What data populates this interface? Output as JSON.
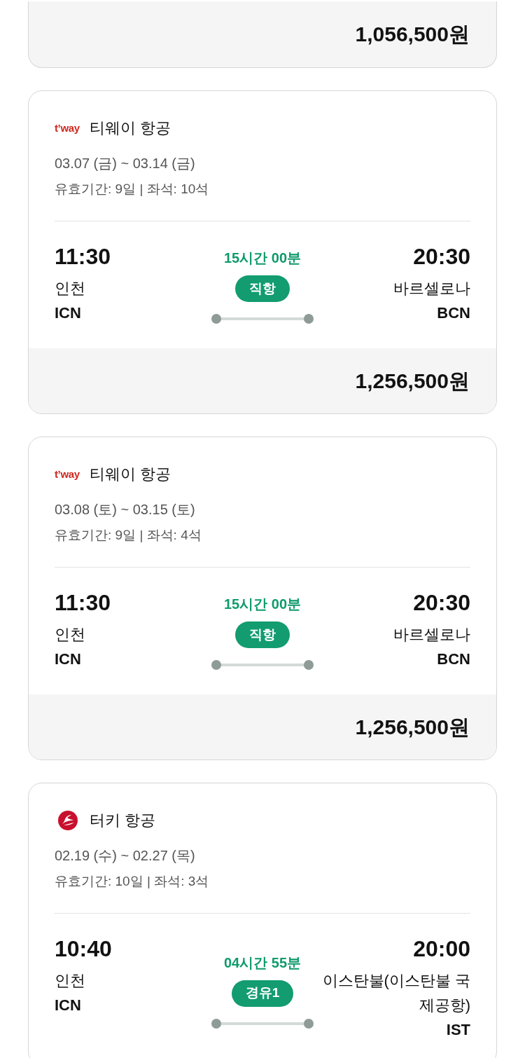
{
  "previous_card": {
    "price": "1,056,500원"
  },
  "flights": [
    {
      "airline": {
        "name": "티웨이 항공",
        "logo": {
          "kind": "wordmark",
          "text": "t’way"
        }
      },
      "dates": "03.07 (금) ~ 03.14 (금)",
      "validity": "유효기간: 9일 | 좌석: 10석",
      "departure": {
        "time": "11:30",
        "city": "인천",
        "code": "ICN"
      },
      "arrival": {
        "time": "20:30",
        "city": "바르셀로나",
        "code": "BCN"
      },
      "duration": "15시간 00분",
      "stops": "직항",
      "price": "1,256,500원"
    },
    {
      "airline": {
        "name": "티웨이 항공",
        "logo": {
          "kind": "wordmark",
          "text": "t’way"
        }
      },
      "dates": "03.08 (토) ~ 03.15 (토)",
      "validity": "유효기간: 9일 | 좌석: 4석",
      "departure": {
        "time": "11:30",
        "city": "인천",
        "code": "ICN"
      },
      "arrival": {
        "time": "20:30",
        "city": "바르셀로나",
        "code": "BCN"
      },
      "duration": "15시간 00분",
      "stops": "직항",
      "price": "1,256,500원"
    },
    {
      "airline": {
        "name": "터키 항공",
        "logo": {
          "kind": "emblem"
        }
      },
      "dates": "02.19 (수) ~ 02.27 (목)",
      "validity": "유효기간: 10일 | 좌석: 3석",
      "departure": {
        "time": "10:40",
        "city": "인천",
        "code": "ICN"
      },
      "arrival": {
        "time": "20:00",
        "city": "이스탄불(이스탄불 국제공항)",
        "code": "IST"
      },
      "duration": "04시간 55분",
      "stops": "경유1"
    }
  ]
}
